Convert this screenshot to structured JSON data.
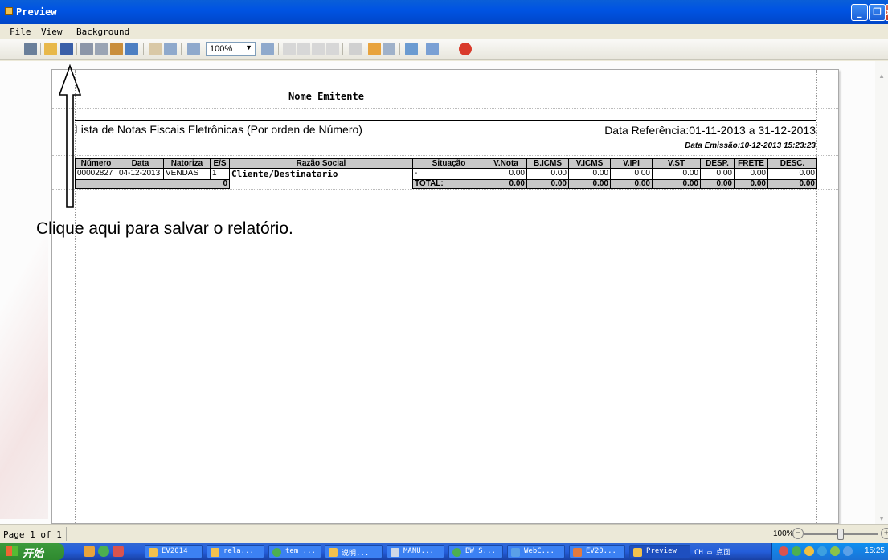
{
  "window": {
    "title": "Preview"
  },
  "menu": [
    "File",
    "View",
    "Background"
  ],
  "toolbar": {
    "zoom_value": "100%",
    "icons": [
      "search-icon",
      "open-folder-icon",
      "save-icon",
      "print-setup-icon",
      "print-icon",
      "export-icon",
      "page-setup-icon",
      "hand-icon",
      "zoom-in-icon",
      "zoom-out-icon",
      "zoom-in-2-icon",
      "first-page-icon",
      "prev-page-icon",
      "next-page-icon",
      "last-page-icon",
      "thumbnail-icon",
      "color-icon",
      "watermark-icon",
      "export-menu-icon",
      "email-icon",
      "close-preview-icon"
    ]
  },
  "report": {
    "emitente": "Nome Emitente",
    "titulo": "Lista de Notas Fiscais Eletrônicas (Por orden de Número)",
    "data_referencia": "Data Referência:01-11-2013  a  31-12-2013",
    "data_emissao": "Data Emissão:10-12-2013 15:23:23",
    "columns": [
      "Número",
      "Data",
      "Natoriza",
      "E/S",
      "Razão Social",
      "Situação",
      "V.Nota",
      "B.ICMS",
      "V.ICMS",
      "V.IPI",
      "V.ST",
      "DESP.",
      "FRETE",
      "DESC."
    ],
    "row": {
      "numero": "00002827",
      "data": "04-12-2013",
      "natureza": "VENDAS",
      "es": "1",
      "razao": "Cliente/Destinatario",
      "situacao": "-",
      "vnota": "0.00",
      "bicms": "0.00",
      "vicms": "0.00",
      "vipi": "0.00",
      "vst": "0.00",
      "desp": "0.00",
      "frete": "0.00",
      "desc": "0.00"
    },
    "totals": {
      "count": "0",
      "label": "TOTAL:",
      "vnota": "0.00",
      "bicms": "0.00",
      "vicms": "0.00",
      "vipi": "0.00",
      "vst": "0.00",
      "desp": "0.00",
      "frete": "0.00",
      "desc": "0.00"
    }
  },
  "annotation": {
    "text": "Clique aqui para salvar o relatório."
  },
  "status": {
    "page_info": "Page 1 of 1",
    "zoom": "100%",
    "zoom_fraction": 0.5
  },
  "taskbar": {
    "start": "开始",
    "tasks": [
      "EV2014",
      "rela...",
      "tem ...",
      "说明...",
      "MANU...",
      "BW S...",
      "WebC...",
      "EV20...",
      "Preview"
    ],
    "lang": "CH",
    "ime": "点面",
    "clock": "15:25"
  }
}
